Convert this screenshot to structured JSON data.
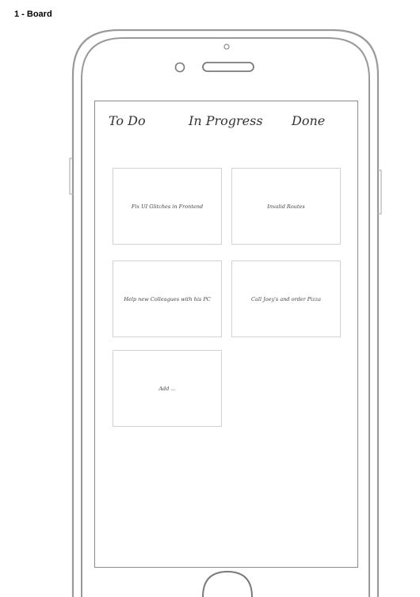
{
  "page_label": "1 - Board",
  "tabs": [
    {
      "label": "To Do"
    },
    {
      "label": "In Progress"
    },
    {
      "label": "Done"
    }
  ],
  "cards": [
    {
      "text": "Fix UI Glitches in Frontend"
    },
    {
      "text": "Invalid Routes"
    },
    {
      "text": "Help new Colleagues with his PC"
    },
    {
      "text": "Call Joey's and order Pizza"
    },
    {
      "text": "Add ..."
    }
  ]
}
